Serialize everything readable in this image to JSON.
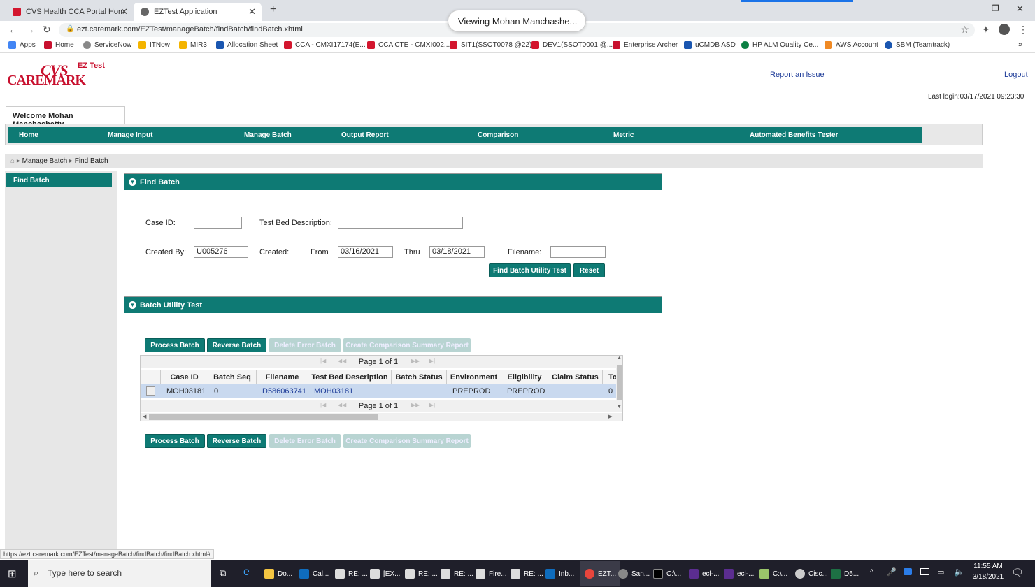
{
  "browser": {
    "tabs": [
      {
        "label": "CVS Health CCA Portal Homepag",
        "active": false
      },
      {
        "label": "EZTest Application",
        "active": true
      }
    ],
    "new_tab_icon": "+",
    "url": "ezt.caremark.com/EZTest/manageBatch/findBatch/findBatch.xhtml",
    "bookmarks": [
      "Apps",
      "Home",
      "ServiceNow",
      "ITNow",
      "MIR3",
      "Allocation Sheet",
      "CCA - CMXI17174(E...",
      "CCA CTE - CMXI002...",
      "SIT1(SSOT0078 @22)",
      "DEV1(SSOT0001 @...",
      "Enterprise Archer",
      "uCMDB ASD",
      "HP ALM Quality Ce...",
      "AWS Account",
      "SBM (Teamtrack)"
    ],
    "viewing_banner": "Viewing Mohan Manchashe..."
  },
  "header": {
    "logo_top": "CVS",
    "logo_bottom": "CAREMARK",
    "app_name": "EZ Test",
    "report_issue": "Report an Issue",
    "logout": "Logout",
    "last_login": "Last login:03/17/2021 09:23:30"
  },
  "welcome": "Welcome Mohan Manchashetty",
  "menu": [
    "Home",
    "Manage Input",
    "Manage Batch",
    "Output Report",
    "Comparison",
    "Metric",
    "Automated Benefits Tester"
  ],
  "breadcrumb": [
    "Manage Batch",
    "Find Batch"
  ],
  "sidebar": {
    "item": "Find Batch"
  },
  "find_batch": {
    "title": "Find Batch",
    "case_id_label": "Case ID:",
    "case_id_value": "",
    "test_bed_label": "Test Bed Description:",
    "test_bed_value": "",
    "created_by_label": "Created By:",
    "created_by_value": "U005276",
    "created_label": "Created:",
    "from_label": "From",
    "from_value": "03/16/2021",
    "thru_label": "Thru",
    "thru_value": "03/18/2021",
    "filename_label": "Filename:",
    "filename_value": "",
    "find_button": "Find Batch Utility Test",
    "reset_button": "Reset"
  },
  "batch_utility": {
    "title": "Batch Utility Test",
    "buttons": {
      "process": "Process Batch",
      "reverse": "Reverse Batch",
      "delete": "Delete Error Batch",
      "compare": "Create Comparison Summary Report"
    },
    "pager": "Page 1 of 1",
    "columns": [
      "Case ID",
      "Batch Seq",
      "Filename",
      "Test Bed Description",
      "Batch Status",
      "Environment",
      "Eligibility",
      "Claim Status",
      "To"
    ],
    "rows": [
      {
        "case_id": "MOH03181",
        "batch_seq": "0",
        "filename": "D586063741",
        "test_bed": "MOH03181",
        "batch_status": "",
        "environment": "PREPROD",
        "eligibility": "PREPROD",
        "claim_status": "",
        "to": "0"
      }
    ]
  },
  "status_url": "https://ezt.caremark.com/EZTest/manageBatch/findBatch/findBatch.xhtml#",
  "taskbar": {
    "search_placeholder": "Type here to search",
    "items": [
      "Do...",
      "Cal...",
      "RE: ...",
      "[EX...",
      "RE: ...",
      "RE: ...",
      "Fire...",
      "RE: ...",
      "Inb...",
      "EZT...",
      "San...",
      "C:\\...",
      "ecl-...",
      "ecl-...",
      "C:\\...",
      "Cisc...",
      "D5..."
    ],
    "time": "11:55 AM",
    "date": "3/18/2021"
  },
  "colors": {
    "teal": "#0e7a74",
    "brand_red": "#c8102e",
    "link": "#1f3d99"
  }
}
